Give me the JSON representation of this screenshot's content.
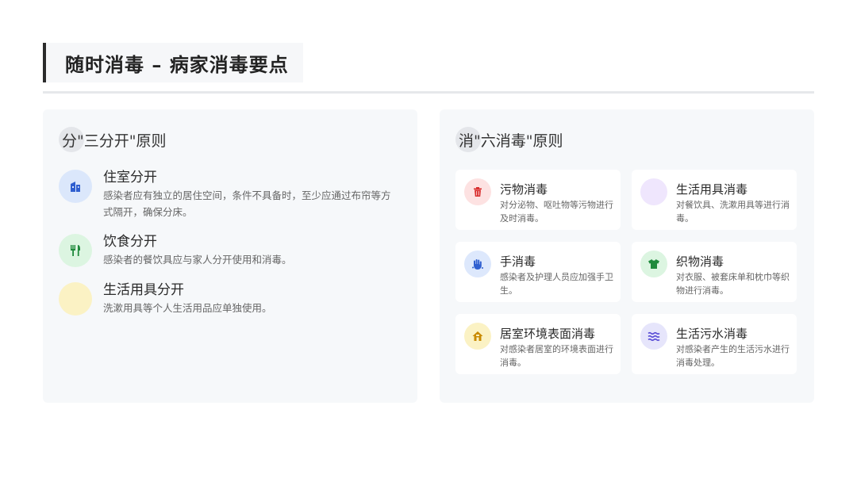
{
  "slide": {
    "title": "随时消毒 – 病家消毒要点"
  },
  "left_panel": {
    "title": "分\"三分开\"原则",
    "items": [
      {
        "title": "住室分开",
        "desc": "感染者应有独立的居住空间，条件不具备时，至少应通过布帘等方式隔开，确保分床。",
        "icon": "building-icon",
        "color": "#dbe7fb",
        "icon_color": "#2f5fd0"
      },
      {
        "title": "饮食分开",
        "desc": "感染者的餐饮具应与家人分开使用和消毒。",
        "icon": "utensils-icon",
        "color": "#dcf5e1",
        "icon_color": "#1f8a3c"
      },
      {
        "title": "生活用具分开",
        "desc": "洗漱用具等个人生活用品应单独使用。",
        "icon": "toiletries-icon",
        "color": "#fbf2c4",
        "icon_color": "#c9a400"
      }
    ]
  },
  "right_panel": {
    "title": "消\"六消毒\"原则",
    "cards": [
      {
        "title": "污物消毒",
        "desc": "对分泌物、呕吐物等污物进行及时消毒。",
        "icon": "trash-icon",
        "color": "#fde2e2",
        "icon_color": "#d93030"
      },
      {
        "title": "生活用具消毒",
        "desc": "对餐饮具、洗漱用具等进行消毒。",
        "icon": "household-items-icon",
        "color": "#efe6fd",
        "icon_color": "#8b5cf6"
      },
      {
        "title": "手消毒",
        "desc": "感染者及护理人员应加强手卫生。",
        "icon": "hand-wash-icon",
        "color": "#dde8fc",
        "icon_color": "#2f5fd0"
      },
      {
        "title": "织物消毒",
        "desc": "对衣服、被套床单和枕巾等织物进行消毒。",
        "icon": "shirt-icon",
        "color": "#dcf5e1",
        "icon_color": "#1f8a3c"
      },
      {
        "title": "居室环境表面消毒",
        "desc": "对感染者居室的环境表面进行消毒。",
        "icon": "house-icon",
        "color": "#fbf2c4",
        "icon_color": "#c98a00"
      },
      {
        "title": "生活污水消毒",
        "desc": "对感染者产生的生活污水进行消毒处理。",
        "icon": "water-icon",
        "color": "#e6e5fb",
        "icon_color": "#5b4fd6"
      }
    ]
  }
}
